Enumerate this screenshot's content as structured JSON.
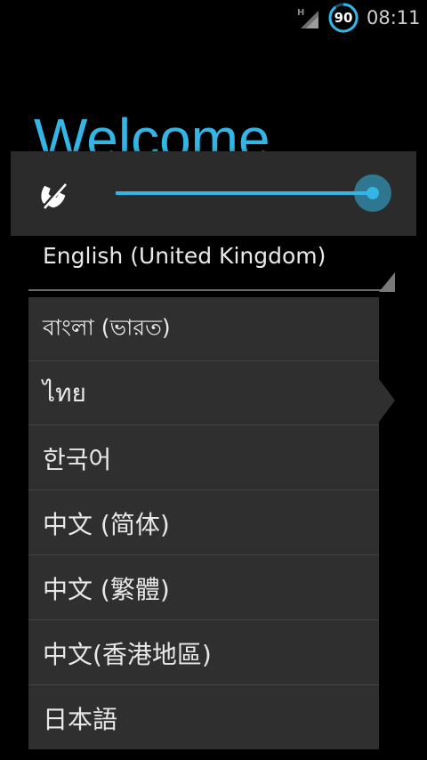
{
  "status_bar": {
    "network_type": "H",
    "battery_level": "90",
    "time": "08:11",
    "icons": [
      "signal-icon",
      "battery-icon"
    ]
  },
  "setup": {
    "title": "Welcome"
  },
  "volume_overlay": {
    "icon": "ringer-icon",
    "level_fraction": 1.0,
    "accent_color": "#33b5e5"
  },
  "language_spinner": {
    "selected": "English (United Kingdom)"
  },
  "language_dropdown": {
    "items": [
      {
        "label": "বাংলা (ভারত)"
      },
      {
        "label": "ไทย"
      },
      {
        "label": "한국어"
      },
      {
        "label": "中文 (简体)"
      },
      {
        "label": "中文 (繁體)"
      },
      {
        "label": "中文(香港地區)"
      },
      {
        "label": "日本語"
      }
    ]
  },
  "colors": {
    "background": "#000000",
    "accent": "#33b5e5",
    "panel": "#2b2b2b",
    "dropdown": "#2f2f2f"
  }
}
